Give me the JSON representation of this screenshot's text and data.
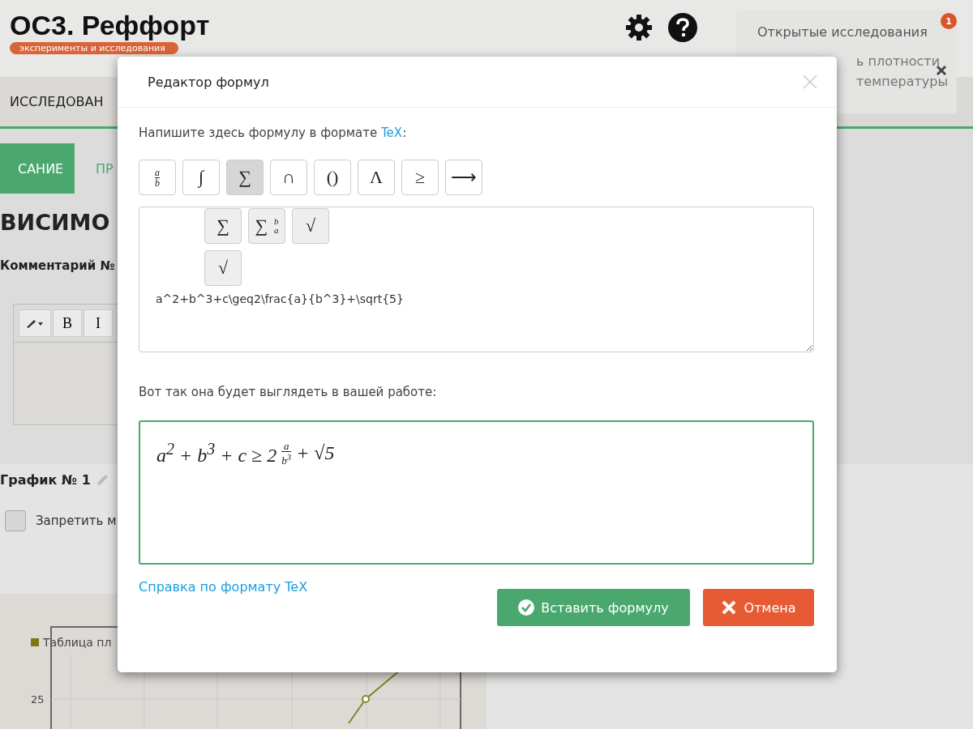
{
  "header": {
    "logo": "ОС3. Реффорт",
    "tagline": "эксперименты и исследования"
  },
  "nav": {
    "label": "ИССЛЕДОВАН"
  },
  "subtabs": [
    {
      "label": "САНИЕ",
      "selected": true
    },
    {
      "label": "ПР",
      "selected": false
    }
  ],
  "heading": "ВИСИМО",
  "comment_label": "Комментарий №",
  "editor_toolbar": [
    {
      "kind": "brush"
    },
    {
      "kind": "text",
      "label": "B"
    },
    {
      "kind": "text",
      "label": "I"
    }
  ],
  "chart_section": {
    "title": "График № 1",
    "lock": {
      "label": "Запретить м",
      "checked": false
    },
    "legend": "Таблица пл",
    "tick": "25"
  },
  "notifications": {
    "title": "Открытые исследования",
    "count": "1",
    "lines": [
      "ь плотности",
      "температуры"
    ]
  },
  "modal": {
    "title": "Редактор формул",
    "instruction": {
      "before": "Напишите здесь формулу в формате ",
      "link": "TeX",
      "after": ":"
    },
    "toolbar": [
      {
        "kind": "fraction",
        "num": "a",
        "den": "b",
        "selected": false
      },
      {
        "kind": "symbol",
        "symbol": "∫",
        "selected": false
      },
      {
        "kind": "symbol",
        "symbol": "∑",
        "selected": true
      },
      {
        "kind": "symbol",
        "symbol": "∩",
        "selected": false
      },
      {
        "kind": "symbol",
        "symbol": "()",
        "selected": false
      },
      {
        "kind": "symbol",
        "symbol": "Λ",
        "selected": false
      },
      {
        "kind": "symbol",
        "symbol": "≥",
        "selected": false
      },
      {
        "kind": "symbol",
        "symbol": "⟶",
        "selected": false
      }
    ],
    "dropdown": [
      {
        "kind": "symbol",
        "symbol": "∑"
      },
      {
        "kind": "limits",
        "symbol": "∑",
        "upper": "b",
        "lower": "a"
      },
      {
        "kind": "symbol",
        "symbol": "√"
      },
      {
        "kind": "symbol",
        "symbol": "√"
      }
    ],
    "value": "a^2+b^3+c\\geq2\\frac{a}{b^3}+\\sqrt{5}",
    "preview_label": "Вот так она будет выглядеть в вашей работе:",
    "preview": {
      "head": "a$^{2}$ + b$^{3}$ + c ≥ 2",
      "num": "a",
      "den": "b$^{3}$",
      "tail": "+ √5"
    },
    "help_link": "Справка по формату TeX",
    "buttons": [
      {
        "kind": "confirm",
        "label": "Вставить формулу"
      },
      {
        "kind": "cancel",
        "label": "Отмена"
      }
    ]
  }
}
